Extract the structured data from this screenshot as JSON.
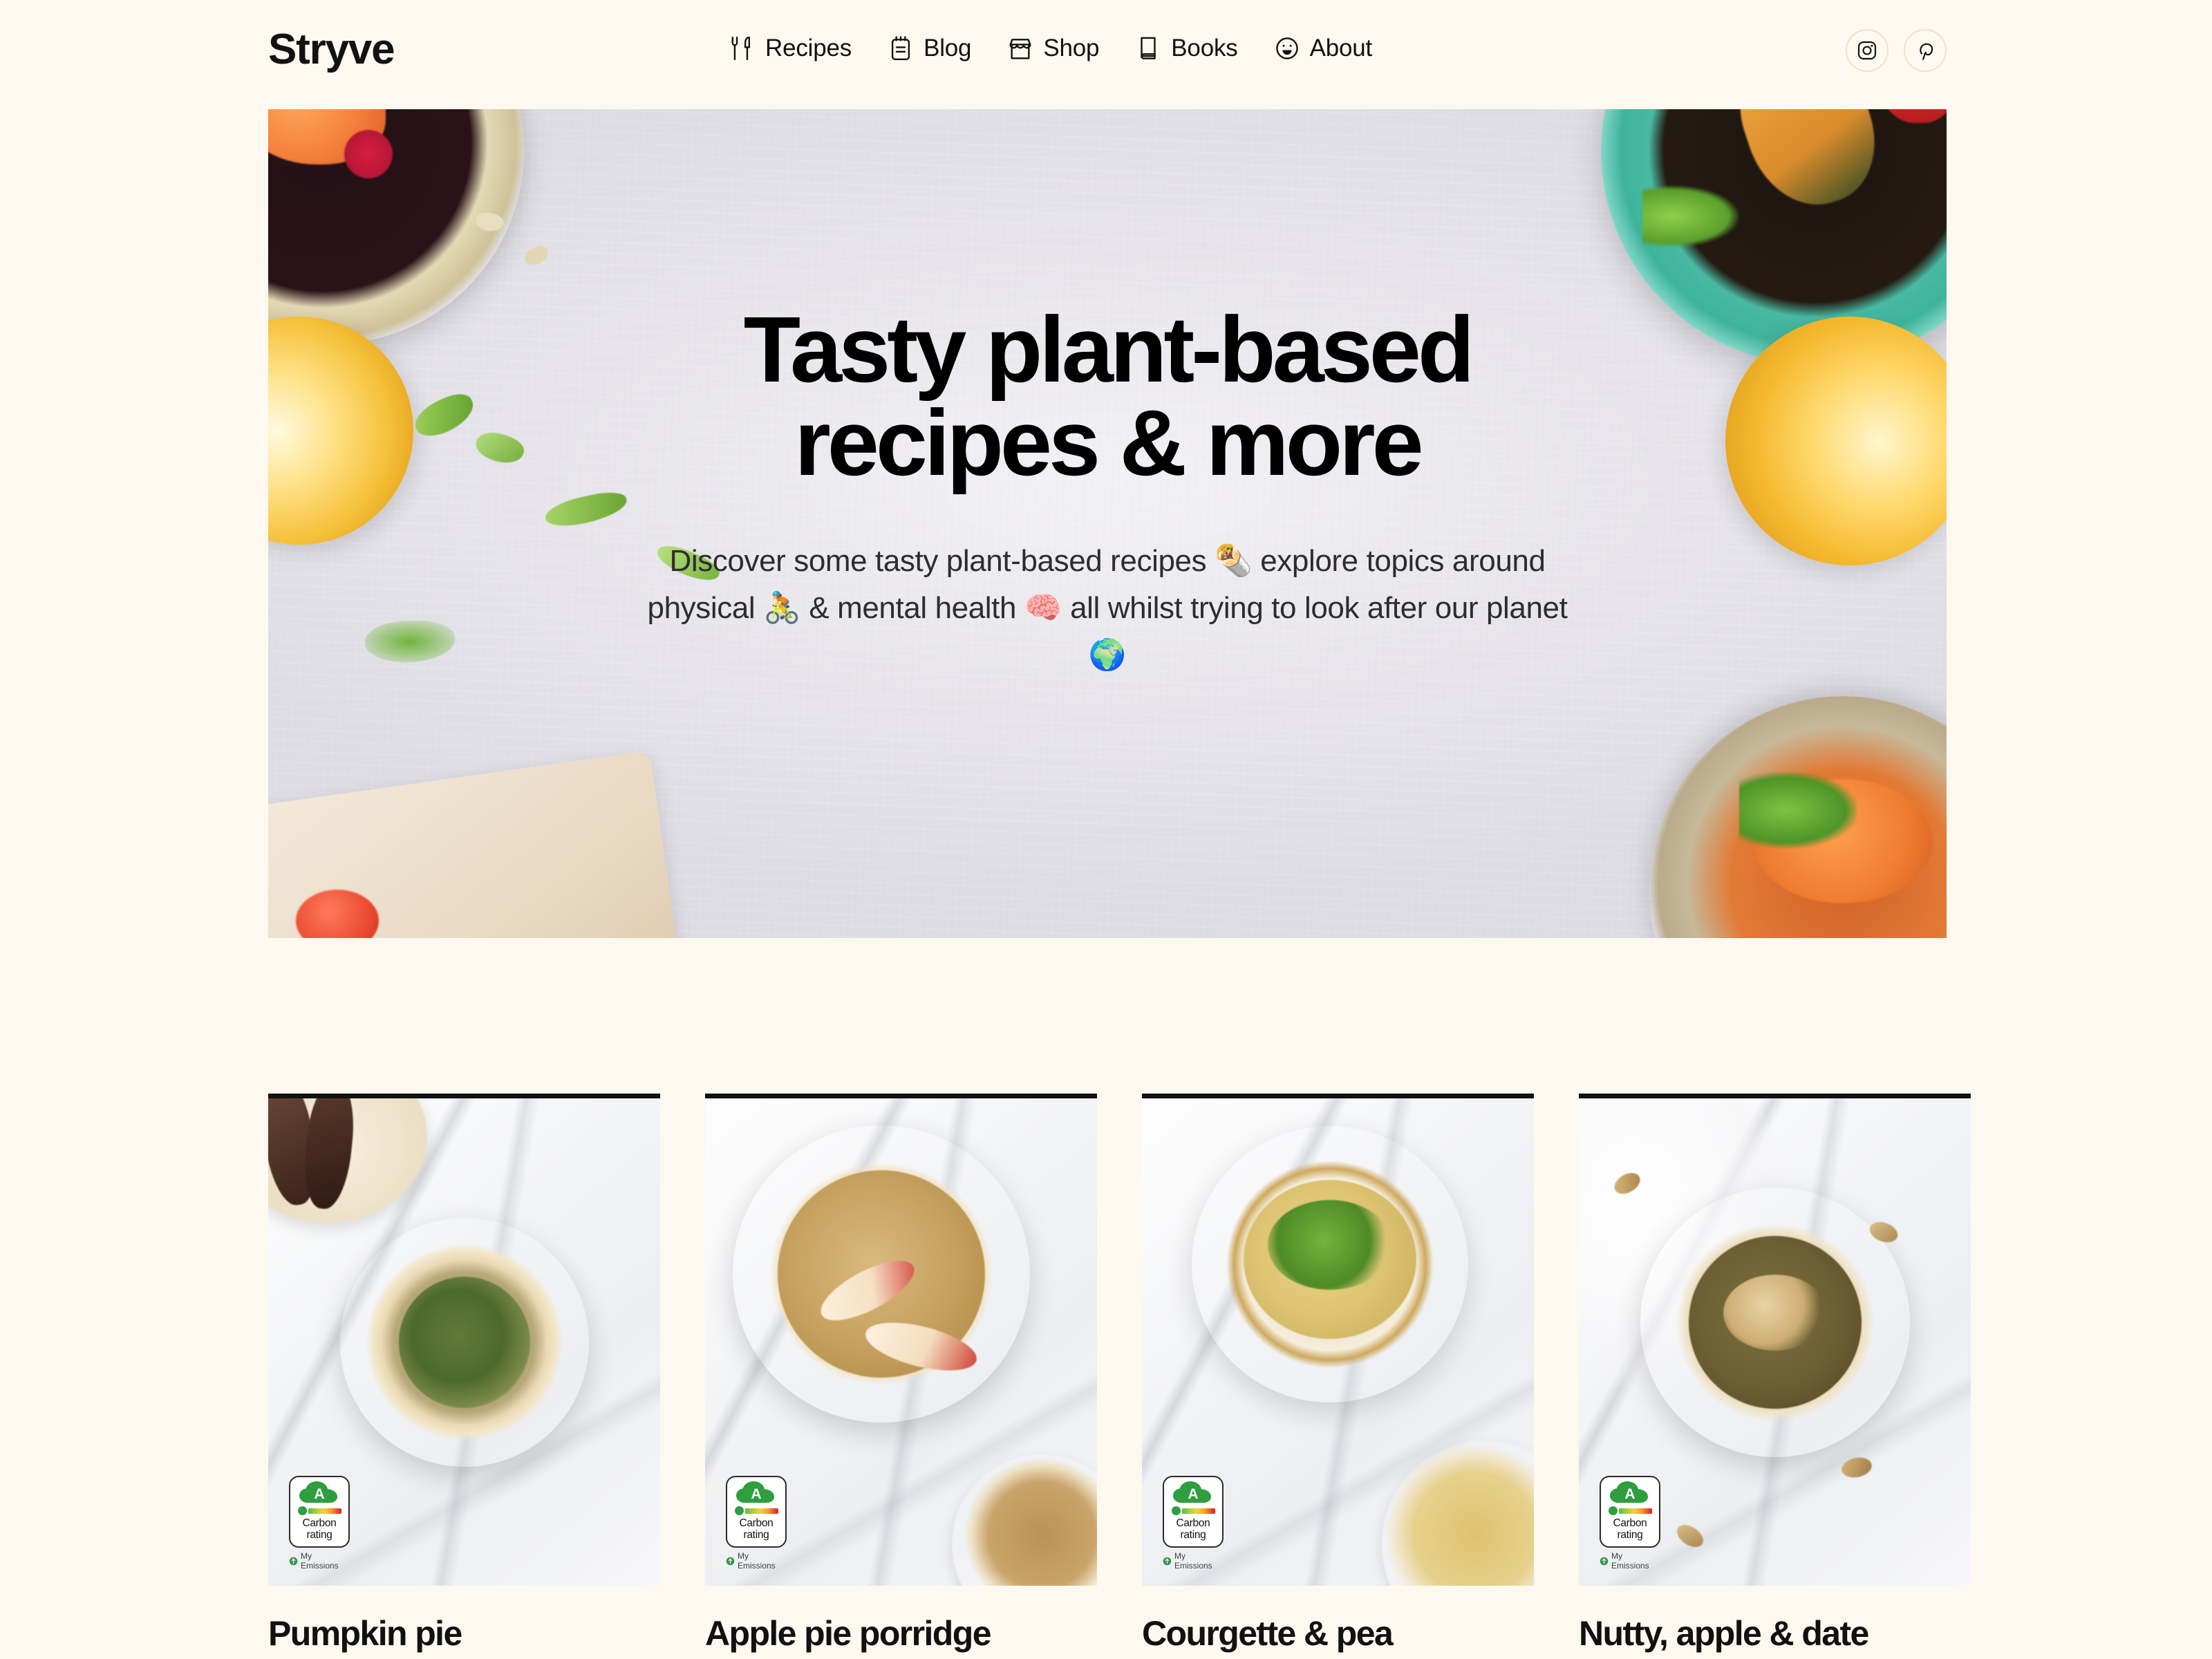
{
  "brand": {
    "name": "Stryve"
  },
  "nav": {
    "items": [
      {
        "label": "Recipes",
        "icon": "fork-knife-icon"
      },
      {
        "label": "Blog",
        "icon": "notepad-icon"
      },
      {
        "label": "Shop",
        "icon": "storefront-icon"
      },
      {
        "label": "Books",
        "icon": "book-icon"
      },
      {
        "label": "About",
        "icon": "smiley-icon"
      }
    ]
  },
  "socials": [
    {
      "name": "instagram",
      "label": "Instagram"
    },
    {
      "name": "pinterest",
      "label": "Pinterest"
    }
  ],
  "hero": {
    "title": "Tasty plant-based recipes & more",
    "subtitle_parts": [
      "Discover some tasty plant-based recipes ",
      "🌯",
      " explore topics around physical ",
      "🚴",
      " & mental health ",
      "🧠",
      " all whilst trying to look after our planet ",
      "🌍"
    ],
    "subtitle": "Discover some tasty plant-based recipes 🌯 explore topics around physical 🚴 & mental health 🧠 all whilst trying to look after our planet 🌍"
  },
  "badge": {
    "grade": "A",
    "label_line1": "Carbon",
    "label_line2": "rating",
    "credit": "My Emissions"
  },
  "cards": [
    {
      "title": "Pumpkin pie",
      "grade": "A"
    },
    {
      "title": "Apple pie porridge",
      "grade": "A"
    },
    {
      "title": "Courgette & pea",
      "grade": "A"
    },
    {
      "title": "Nutty, apple & date",
      "grade": "A"
    }
  ],
  "colors": {
    "page_bg": "#fdf9f0",
    "text": "#111111",
    "social_border": "#efe2c8",
    "badge_green": "#2e9e3e",
    "card_rule": "#111111"
  }
}
